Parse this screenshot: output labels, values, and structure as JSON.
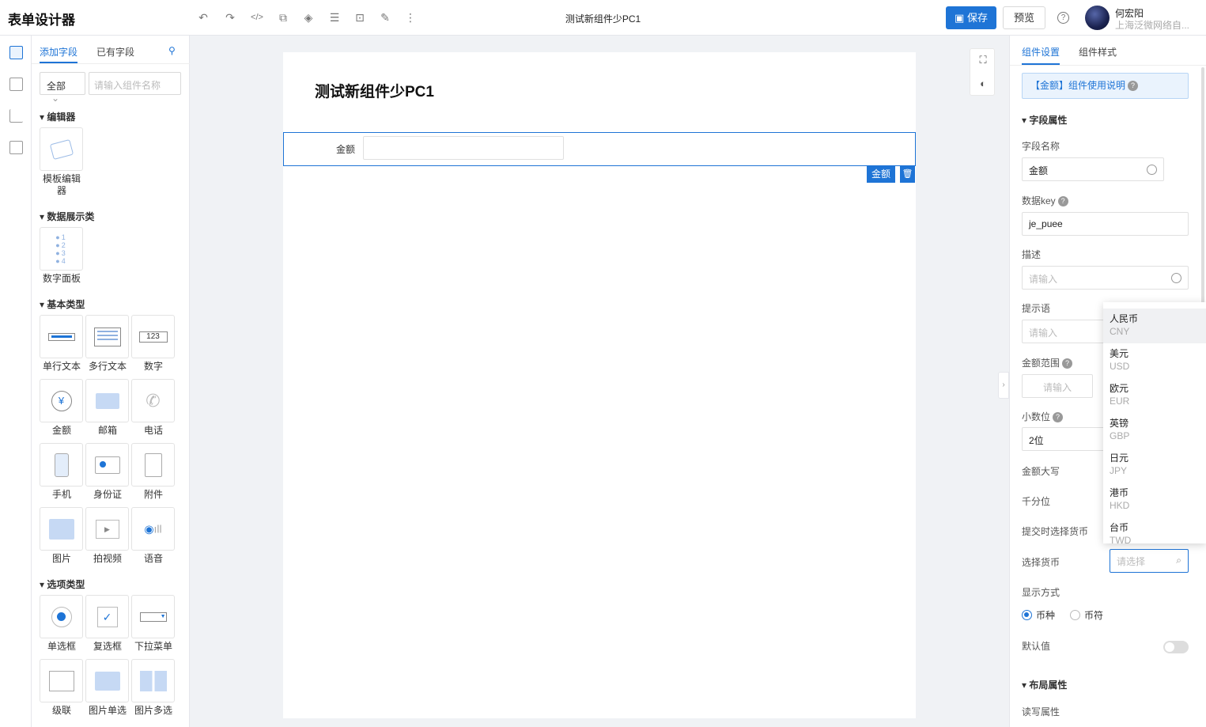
{
  "app": {
    "title": "表单设计器",
    "page_name": "测试新组件少PC1"
  },
  "header": {
    "save_label": "保存",
    "preview_label": "预览",
    "help_icon": "?",
    "user": {
      "name": "何宏阳",
      "org": "上海泛微网络自..."
    }
  },
  "left_panel": {
    "tabs": [
      "添加字段",
      "已有字段"
    ],
    "filter_value": "全部",
    "search_placeholder": "请输入组件名称",
    "sections": [
      {
        "title": "编辑器",
        "items": [
          {
            "label": "模板编辑",
            "label2": "器",
            "icon": "template-editor-icon"
          }
        ]
      },
      {
        "title": "数据展示类",
        "items": [
          {
            "label": "数字面板",
            "icon": "number-panel-icon"
          }
        ]
      },
      {
        "title": "基本类型",
        "items": [
          {
            "label": "单行文本",
            "icon": "single-line-text-icon"
          },
          {
            "label": "多行文本",
            "icon": "multi-line-text-icon"
          },
          {
            "label": "数字",
            "icon": "number-icon",
            "glyph": "123"
          },
          {
            "label": "金额",
            "icon": "amount-icon",
            "glyph": "¥"
          },
          {
            "label": "邮箱",
            "icon": "email-icon"
          },
          {
            "label": "电话",
            "icon": "phone-icon"
          },
          {
            "label": "手机",
            "icon": "mobile-icon"
          },
          {
            "label": "身份证",
            "icon": "id-card-icon"
          },
          {
            "label": "附件",
            "icon": "attachment-icon"
          },
          {
            "label": "图片",
            "icon": "image-icon"
          },
          {
            "label": "拍视频",
            "icon": "video-icon"
          },
          {
            "label": "语音",
            "icon": "voice-icon"
          }
        ]
      },
      {
        "title": "选项类型",
        "items": [
          {
            "label": "单选框",
            "icon": "radio-icon"
          },
          {
            "label": "复选框",
            "icon": "checkbox-icon",
            "glyph": "✓"
          },
          {
            "label": "下拉菜单",
            "icon": "dropdown-icon"
          },
          {
            "label": "级联",
            "icon": "cascade-icon"
          },
          {
            "label": "图片单选",
            "icon": "image-radio-icon"
          },
          {
            "label": "图片多选",
            "icon": "image-multi-icon"
          }
        ]
      }
    ]
  },
  "canvas": {
    "form_title": "测试新组件少PC1",
    "field": {
      "label": "金额",
      "tag": "金额",
      "delete_icon": "🗑"
    }
  },
  "right_panel": {
    "tabs": [
      "组件设置",
      "组件样式"
    ],
    "usage": "【金额】组件使用说明",
    "field_props_title": "字段属性",
    "field_name_label": "字段名称",
    "field_name_value": "金额",
    "data_key_label": "数据key",
    "data_key_value": "je_puee",
    "desc_label": "描述",
    "desc_placeholder": "请输入",
    "hint_label": "提示语",
    "hint_placeholder": "请输入",
    "range_label": "金额范围",
    "range_placeholder": "请输入",
    "decimals_label": "小数位",
    "decimals_value": "2位",
    "uppercase_label": "金额大写",
    "thousands_label": "千分位",
    "submit_currency_label": "提交时选择货币",
    "select_currency_label": "选择货币",
    "select_currency_placeholder": "请选择",
    "display_label": "显示方式",
    "display_options": [
      "币种",
      "币符"
    ],
    "default_label": "默认值",
    "layout_title": "布局属性",
    "readwrite_label": "读写属性"
  },
  "currency_dropdown": [
    {
      "name": "人民币",
      "code": "CNY"
    },
    {
      "name": "美元",
      "code": "USD"
    },
    {
      "name": "欧元",
      "code": "EUR"
    },
    {
      "name": "英镑",
      "code": "GBP"
    },
    {
      "name": "日元",
      "code": "JPY"
    },
    {
      "name": "港币",
      "code": "HKD"
    },
    {
      "name": "台币",
      "code": "TWD"
    }
  ]
}
